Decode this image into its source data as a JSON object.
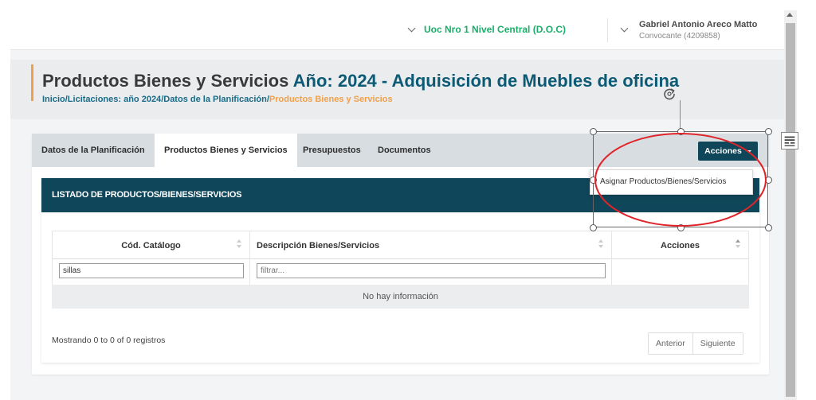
{
  "header": {
    "org_name": "Uoc Nro 1 Nivel Central (D.O.C)",
    "user_name": "Gabriel Antonio Areco Matto",
    "user_role": "Convocante (4209858)"
  },
  "page": {
    "title_part1": "Productos Bienes y Servicios",
    "title_part2": "Año: 2024 - Adquisición de Muebles de oficina",
    "breadcrumb": {
      "inicio": "Inicio",
      "licitaciones": "Licitaciones: año 2024",
      "datos": "Datos de la Planificación",
      "current": "Productos Bienes y Servicios",
      "separator": "/"
    }
  },
  "tabs": [
    {
      "label": "Datos de la Planificación",
      "active": false
    },
    {
      "label": "Productos Bienes y Servicios",
      "active": true
    },
    {
      "label": "Presupuestos",
      "active": false
    },
    {
      "label": "Documentos",
      "active": false
    }
  ],
  "actions_button": {
    "label": "Acciones"
  },
  "actions_menu": {
    "items": [
      "Asignar Productos/Bienes/Servicios"
    ]
  },
  "panel": {
    "title": "LISTADO DE PRODUCTOS/BIENES/SERVICIOS",
    "columns": [
      "Cód. Catálogo",
      "Descripción Bienes/Servicios",
      "Acciones"
    ],
    "filters": {
      "cod_value": "sillas",
      "desc_placeholder": "filtrar..."
    },
    "empty_text": "No hay información",
    "records_text": "Mostrando 0 to 0 of 0 registros",
    "pager": {
      "prev": "Anterior",
      "next": "Siguiente"
    }
  },
  "colors": {
    "accent_orange": "#f0a04b",
    "brand_teal": "#0f4659",
    "title_blue": "#0d5a75",
    "org_green": "#1cae6a",
    "annotation_red": "#e0242a"
  }
}
